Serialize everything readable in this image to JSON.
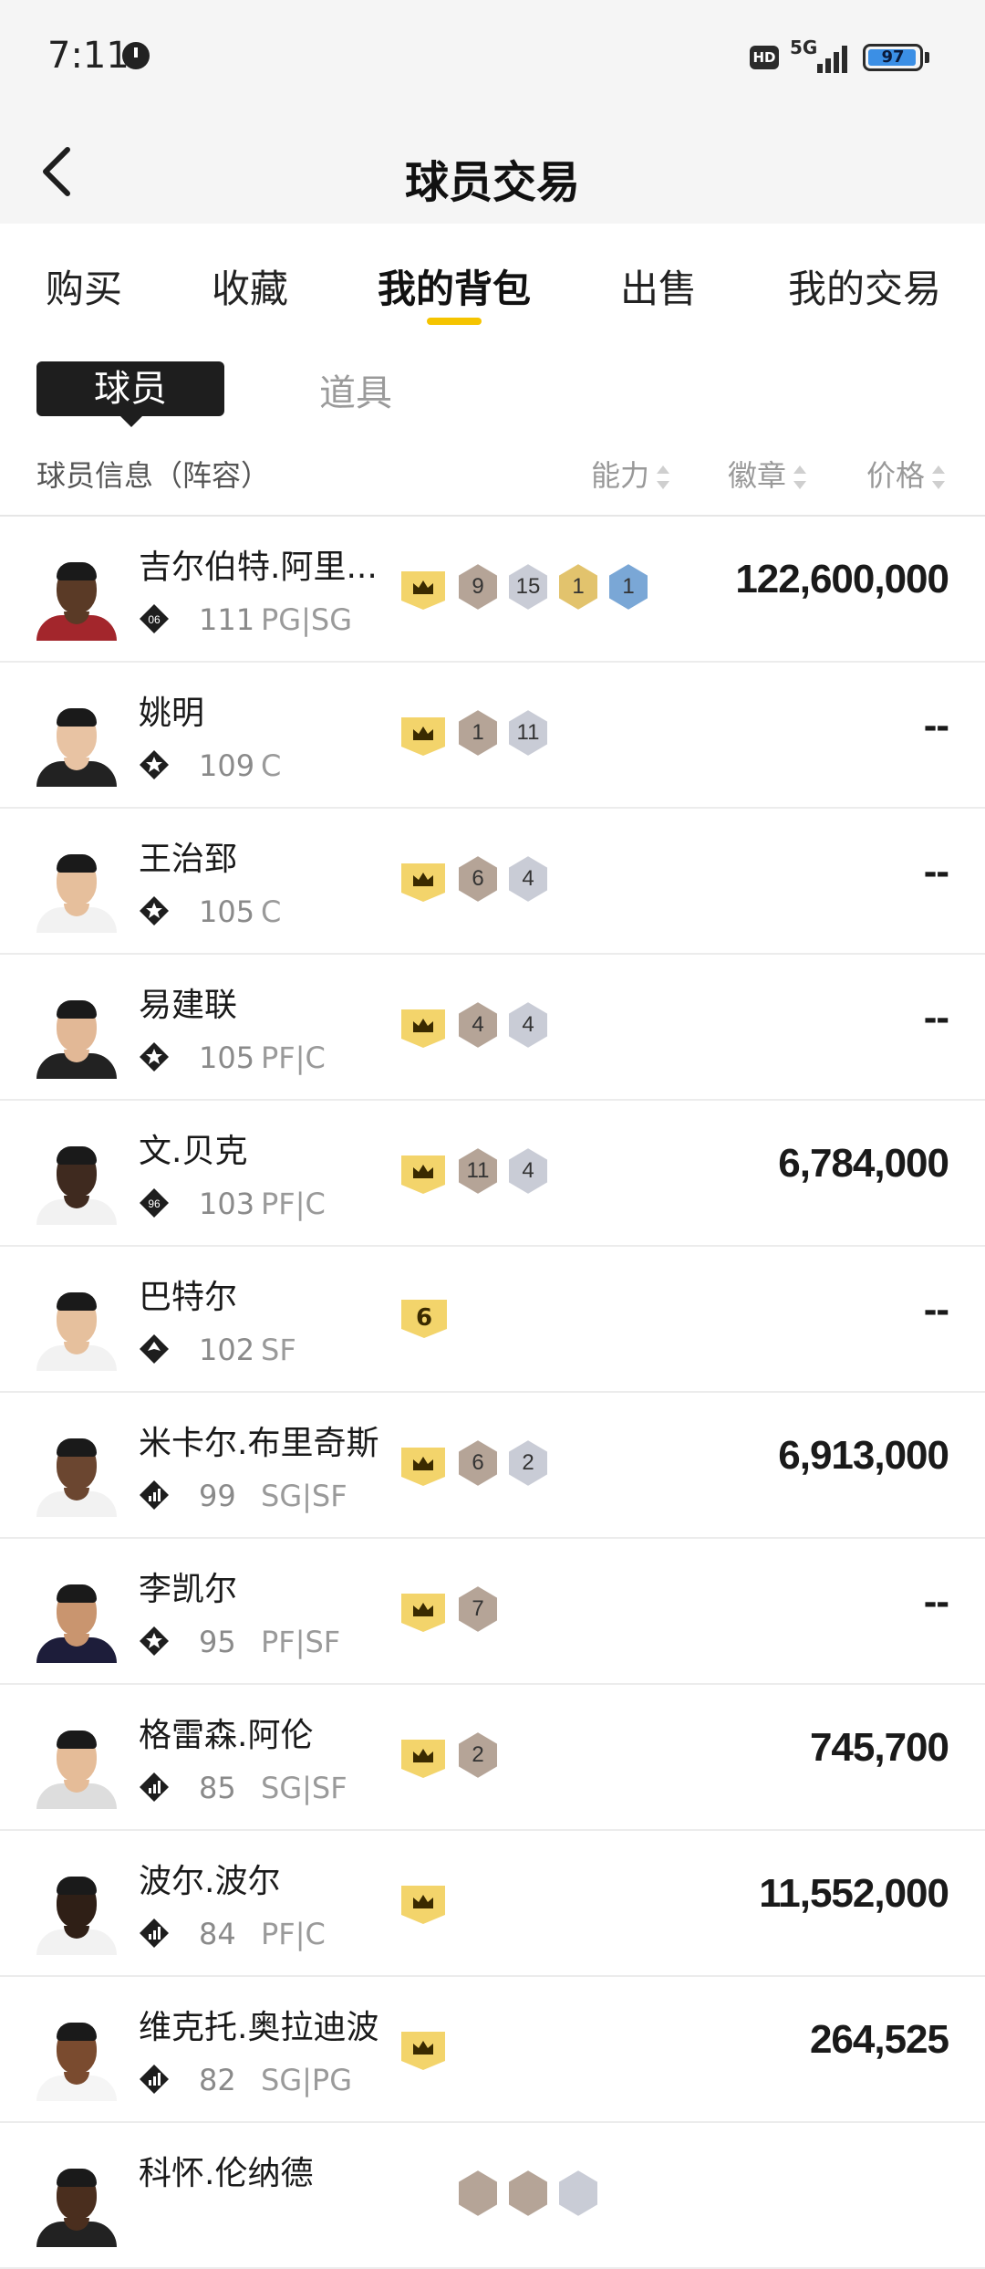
{
  "status_bar": {
    "time": "7:11",
    "hd": "HD",
    "network": "5G",
    "battery": "97",
    "battery_level": 0.97
  },
  "header": {
    "title": "球员交易",
    "back_icon": "chevron-left-icon"
  },
  "tabs": [
    {
      "label": "购买",
      "active": false
    },
    {
      "label": "收藏",
      "active": false
    },
    {
      "label": "我的背包",
      "active": true
    },
    {
      "label": "出售",
      "active": false
    },
    {
      "label": "我的交易",
      "active": false
    }
  ],
  "subtabs": {
    "player": "球员",
    "item": "道具"
  },
  "table_header": {
    "info": "球员信息（阵容）",
    "ability": "能力",
    "badge": "徽章",
    "price": "价格"
  },
  "colors": {
    "accent": "#f5c400",
    "crown": "#f3d46b",
    "bronze": "#b5a497",
    "silver": "#c9ccd6",
    "gold": "#e2c36d",
    "blue": "#7aa7d6"
  },
  "players": [
    {
      "name": "吉尔伯特.阿里...",
      "ability": "111",
      "position": "PG|SG",
      "rank_label": "06",
      "rank_icon": "rank-diamond-06-icon",
      "crown": true,
      "level": "",
      "badges": [
        {
          "n": "9",
          "tier": "bronze"
        },
        {
          "n": "15",
          "tier": "silver"
        },
        {
          "n": "1",
          "tier": "gold"
        },
        {
          "n": "1",
          "tier": "blue"
        }
      ],
      "price": "122,600,000"
    },
    {
      "name": "姚明",
      "ability": "109",
      "position": "C",
      "rank_label": "",
      "rank_icon": "rank-star-icon",
      "crown": true,
      "level": "",
      "badges": [
        {
          "n": "1",
          "tier": "bronze"
        },
        {
          "n": "11",
          "tier": "silver"
        }
      ],
      "price": "--"
    },
    {
      "name": "王治郅",
      "ability": "105",
      "position": "C",
      "rank_label": "",
      "rank_icon": "rank-star-icon",
      "crown": true,
      "level": "",
      "badges": [
        {
          "n": "6",
          "tier": "bronze"
        },
        {
          "n": "4",
          "tier": "silver"
        }
      ],
      "price": "--"
    },
    {
      "name": "易建联",
      "ability": "105",
      "position": "PF|C",
      "rank_label": "",
      "rank_icon": "rank-star-icon",
      "crown": true,
      "level": "",
      "badges": [
        {
          "n": "4",
          "tier": "bronze"
        },
        {
          "n": "4",
          "tier": "silver"
        }
      ],
      "price": "--"
    },
    {
      "name": "文.贝克",
      "ability": "103",
      "position": "PF|C",
      "rank_label": "96",
      "rank_icon": "rank-diamond-96-icon",
      "crown": true,
      "level": "",
      "badges": [
        {
          "n": "11",
          "tier": "bronze"
        },
        {
          "n": "4",
          "tier": "silver"
        }
      ],
      "price": "6,784,000"
    },
    {
      "name": "巴特尔",
      "ability": "102",
      "position": "SF",
      "rank_label": "",
      "rank_icon": "rank-spade-icon",
      "crown": false,
      "level": "6",
      "badges": [],
      "price": "--"
    },
    {
      "name": "米卡尔.布里奇斯",
      "ability": "99",
      "position": "SG|SF",
      "rank_label": "",
      "rank_icon": "rank-bars-icon",
      "crown": true,
      "level": "",
      "badges": [
        {
          "n": "6",
          "tier": "bronze"
        },
        {
          "n": "2",
          "tier": "silver"
        }
      ],
      "price": "6,913,000"
    },
    {
      "name": "李凯尔",
      "ability": "95",
      "position": "PF|SF",
      "rank_label": "",
      "rank_icon": "rank-star-icon",
      "crown": true,
      "level": "",
      "badges": [
        {
          "n": "7",
          "tier": "bronze"
        }
      ],
      "price": "--"
    },
    {
      "name": "格雷森.阿伦",
      "ability": "85",
      "position": "SG|SF",
      "rank_label": "",
      "rank_icon": "rank-bars-icon",
      "crown": true,
      "level": "",
      "badges": [
        {
          "n": "2",
          "tier": "bronze"
        }
      ],
      "price": "745,700"
    },
    {
      "name": "波尔.波尔",
      "ability": "84",
      "position": "PF|C",
      "rank_label": "",
      "rank_icon": "rank-bars-icon",
      "crown": true,
      "level": "",
      "badges": [],
      "price": "11,552,000"
    },
    {
      "name": "维克托.奥拉迪波",
      "ability": "82",
      "position": "SG|PG",
      "rank_label": "",
      "rank_icon": "rank-bars-icon",
      "crown": true,
      "level": "",
      "badges": [],
      "price": "264,525"
    },
    {
      "name": "科怀.伦纳德",
      "ability": "",
      "position": "",
      "rank_label": "",
      "rank_icon": "",
      "crown": false,
      "level": "",
      "badges": [
        {
          "n": "",
          "tier": "bronze"
        },
        {
          "n": "",
          "tier": "bronze"
        },
        {
          "n": "",
          "tier": "silver"
        }
      ],
      "price": ""
    }
  ]
}
